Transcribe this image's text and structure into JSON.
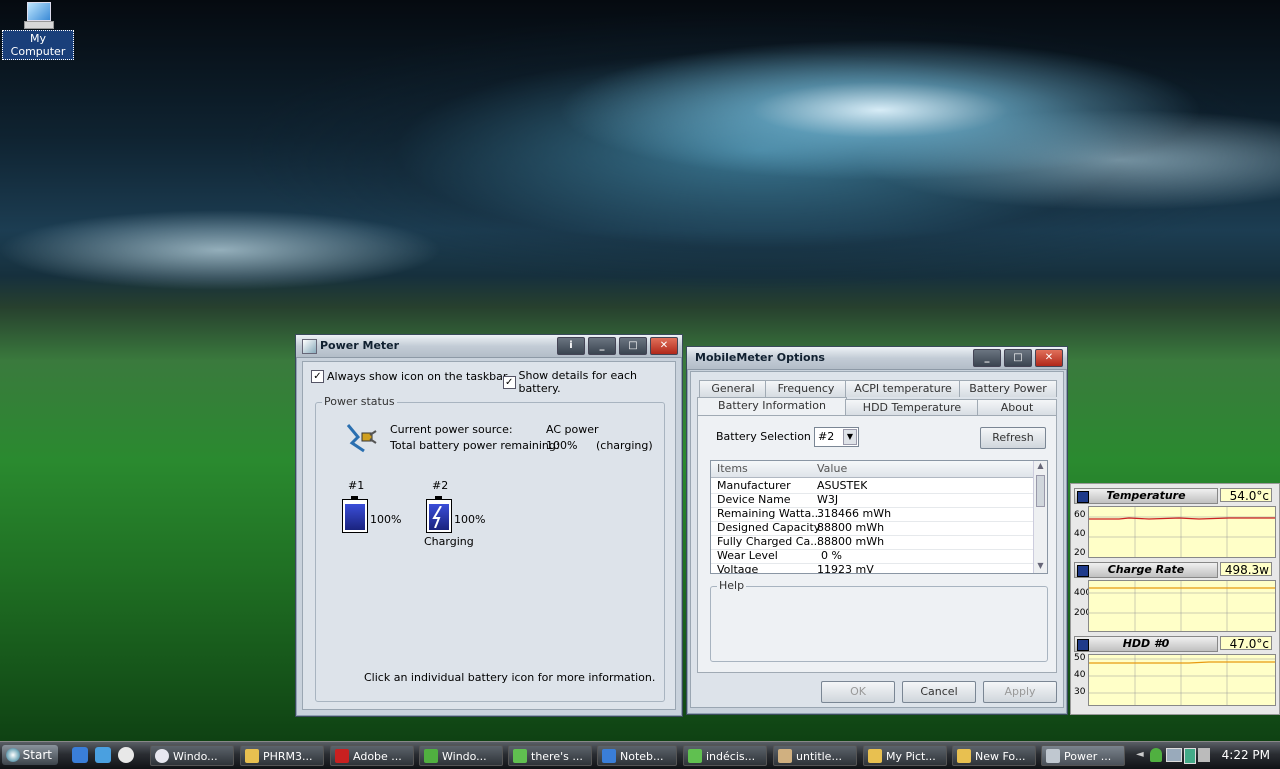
{
  "desktop": {
    "icon_label": "My Computer"
  },
  "power_meter": {
    "title": "Power Meter",
    "always_show_icon": "Always show icon on the taskbar.",
    "show_details": "Show details for each battery.",
    "group_label": "Power status",
    "current_source_label": "Current power source:",
    "current_source_value": "AC power",
    "total_remaining_label": "Total battery power remaining:",
    "total_remaining_value": "100%",
    "total_remaining_status": "(charging)",
    "battery1": {
      "label": "#1",
      "percent": "100%",
      "status": ""
    },
    "battery2": {
      "label": "#2",
      "percent": "100%",
      "status": "Charging"
    },
    "footer_hint": "Click an individual battery icon for more information."
  },
  "mobilemeter": {
    "title": "MobileMeter Options",
    "tabs_row1": [
      "General",
      "Frequency",
      "ACPI temperature",
      "Battery Power"
    ],
    "tabs_row2": [
      "Battery Information",
      "HDD Temperature",
      "About"
    ],
    "selected_tab": "Battery Information",
    "battery_selection_label": "Battery Selection",
    "battery_selection_value": "#2",
    "refresh_label": "Refresh",
    "columns": [
      "Items",
      "Value"
    ],
    "rows": [
      {
        "item": "Manufacturer",
        "value": "ASUSTEK"
      },
      {
        "item": "Device Name",
        "value": "W3J"
      },
      {
        "item": "Remaining Watta...",
        "value": "318466 mWh"
      },
      {
        "item": "Designed Capacity",
        "value": "88800 mWh"
      },
      {
        "item": "Fully Charged Ca...",
        "value": "88800 mWh"
      },
      {
        "item": "Wear Level",
        "value": "0 %"
      },
      {
        "item": "Voltage",
        "value": "11923 mV"
      }
    ],
    "help_label": "Help",
    "ok_label": "OK",
    "cancel_label": "Cancel",
    "apply_label": "Apply"
  },
  "gadget": {
    "sections": [
      {
        "name": "Temperature",
        "value": "54.0°c",
        "ticks": [
          "60",
          "40",
          "20"
        ]
      },
      {
        "name": "Charge Rate",
        "value": "498.3w",
        "ticks": [
          "400",
          "200"
        ]
      },
      {
        "name": "HDD #0",
        "value": "47.0°c",
        "ticks": [
          "50",
          "40",
          "30"
        ]
      }
    ]
  },
  "taskbar": {
    "start_label": "Start",
    "tasks": [
      "Windo...",
      "PHRM3...",
      "Adobe ...",
      "Windo...",
      "there's ...",
      "Noteb...",
      "indécis...",
      "untitle...",
      "My Pict...",
      "New Fo...",
      "Power ..."
    ],
    "clock": "4:22 PM"
  },
  "colors": {
    "taskbar": "#1a1d21",
    "gadget_plot": "#ffffc8",
    "chart_line_red": "#cc2222",
    "chart_line_orange": "#e89a10"
  }
}
